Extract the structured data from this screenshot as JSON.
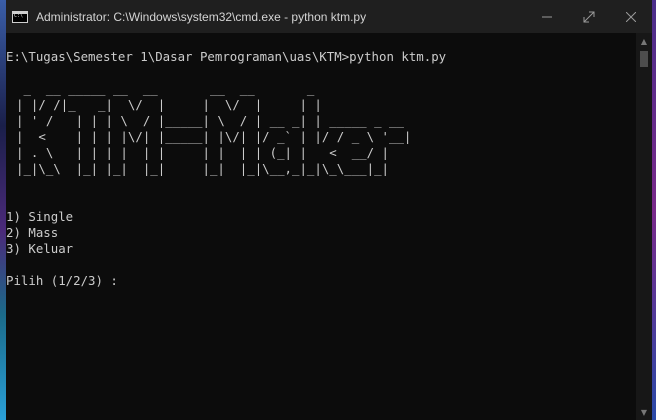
{
  "window": {
    "title": "Administrator: C:\\Windows\\system32\\cmd.exe - python  ktm.py"
  },
  "icons": {
    "window_icon": "cmd-icon",
    "minimize": "minimize-icon",
    "maximize": "maximize-icon",
    "close": "close-icon"
  },
  "console": {
    "command_line": "E:\\Tugas\\Semester 1\\Dasar Pemrograman\\uas\\KTM>python ktm.py",
    "ascii_banner": " _  __ _____ __  __       __  __       _\n| |/ /|_   _|  \\/  |     |  \\/  |     | |\n| ' /   | | | \\  / |_____| \\  / | __ _| | _____ _ __\n|  <    | | | |\\/| |_____| |\\/| |/ _` | |/ / _ \\ '__|\n| . \\   | | | |  | |     | |  | | (_| |   <  __/ |\n|_|\\_\\  |_| |_|  |_|     |_|  |_|\\__,_|_|\\_\\___|_|",
    "menu": [
      "1) Single",
      "2) Mass",
      "3) Keluar"
    ],
    "prompt": "Pilih (1/2/3) : "
  },
  "colors": {
    "titlebar": "#1f1f1f",
    "console_bg": "#0c0c0c",
    "console_text": "#cccccc"
  }
}
